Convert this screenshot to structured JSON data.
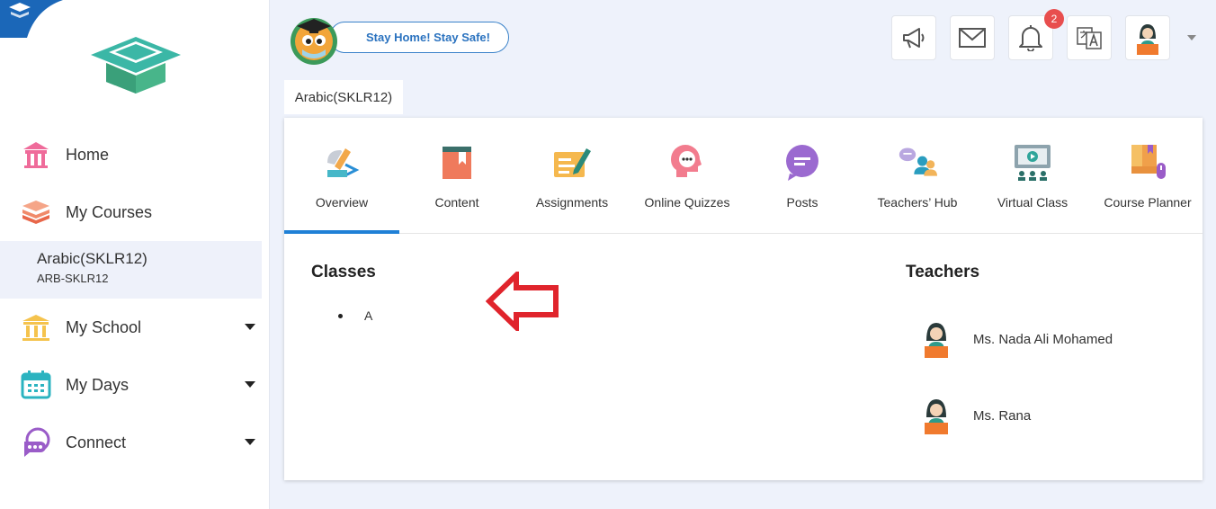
{
  "sidebar": {
    "items": [
      {
        "label": "Home",
        "icon": "home-icon"
      },
      {
        "label": "My Courses",
        "icon": "courses-icon"
      },
      {
        "label": "My School",
        "icon": "school-icon"
      },
      {
        "label": "My Days",
        "icon": "calendar-icon"
      },
      {
        "label": "Connect",
        "icon": "connect-icon"
      }
    ],
    "active_course": {
      "name": "Arabic(SKLR12)",
      "code": "ARB-SKLR12"
    }
  },
  "header": {
    "slogan": "Stay Home! Stay Safe!",
    "notifications_count": "2",
    "icons": [
      "megaphone-icon",
      "mail-icon",
      "bell-icon",
      "translate-icon",
      "user-avatar-icon"
    ]
  },
  "course_tab": "Arabic(SKLR12)",
  "tabs": [
    {
      "label": "Overview",
      "icon": "overview-icon",
      "active": true
    },
    {
      "label": "Content",
      "icon": "book-icon"
    },
    {
      "label": "Assignments",
      "icon": "assignment-icon"
    },
    {
      "label": "Online Quizzes",
      "icon": "quiz-icon"
    },
    {
      "label": "Posts",
      "icon": "posts-icon"
    },
    {
      "label": "Teachers’ Hub",
      "icon": "teachers-hub-icon"
    },
    {
      "label": "Virtual Class",
      "icon": "virtual-class-icon"
    },
    {
      "label": "Course Planner",
      "icon": "planner-icon"
    }
  ],
  "classes": {
    "title": "Classes",
    "items": [
      "A"
    ]
  },
  "teachers": {
    "title": "Teachers",
    "items": [
      "Ms. Nada Ali Mohamed",
      "Ms. Rana"
    ]
  },
  "colors": {
    "accent": "#1f80d6",
    "badge": "#e84e4e",
    "arrow": "#e0242c"
  }
}
